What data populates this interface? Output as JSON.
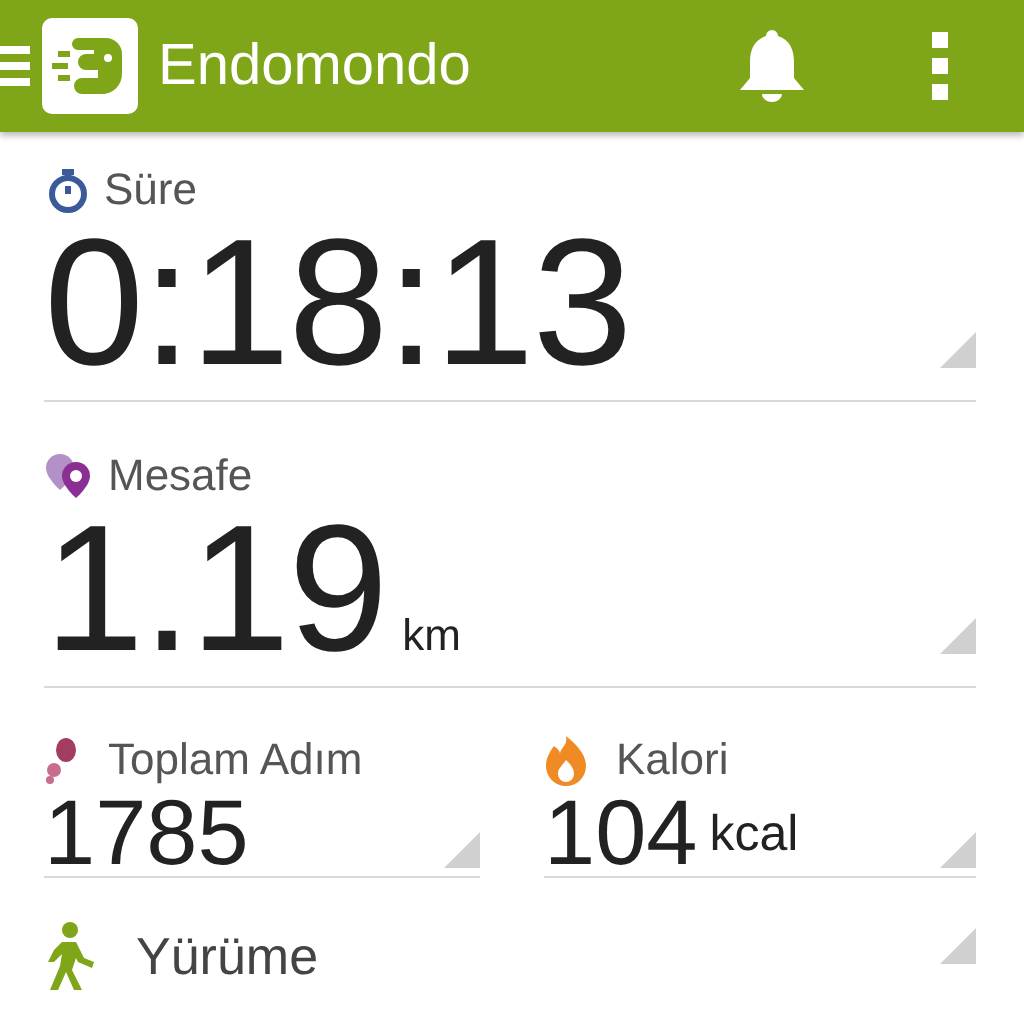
{
  "app_bar": {
    "title": "Endomondo"
  },
  "metrics": [
    {
      "label": "Süre",
      "value": "0:18:13",
      "kind": "large"
    },
    {
      "label": "Mesafe",
      "value": "1.19",
      "unit": "km",
      "kind": "large"
    },
    {
      "label": "Toplam Adım",
      "value": "1785",
      "kind": "small"
    },
    {
      "label": "Kalori",
      "value": "104",
      "unit": "kcal",
      "kind": "small"
    }
  ],
  "sport": {
    "label": "Yürüme"
  }
}
